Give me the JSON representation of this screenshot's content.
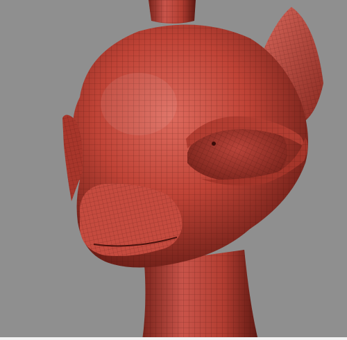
{
  "scene": {
    "subject": "red-wireframe-pony-head",
    "background_color": "#8f8f8f",
    "mesh_color": "#c2463a",
    "mesh_shadow_color": "#6e1f18",
    "mesh_highlight_color": "#e0766a",
    "wire_color": "#3a0c08",
    "bottom_border_color": "#f2f2f2"
  }
}
